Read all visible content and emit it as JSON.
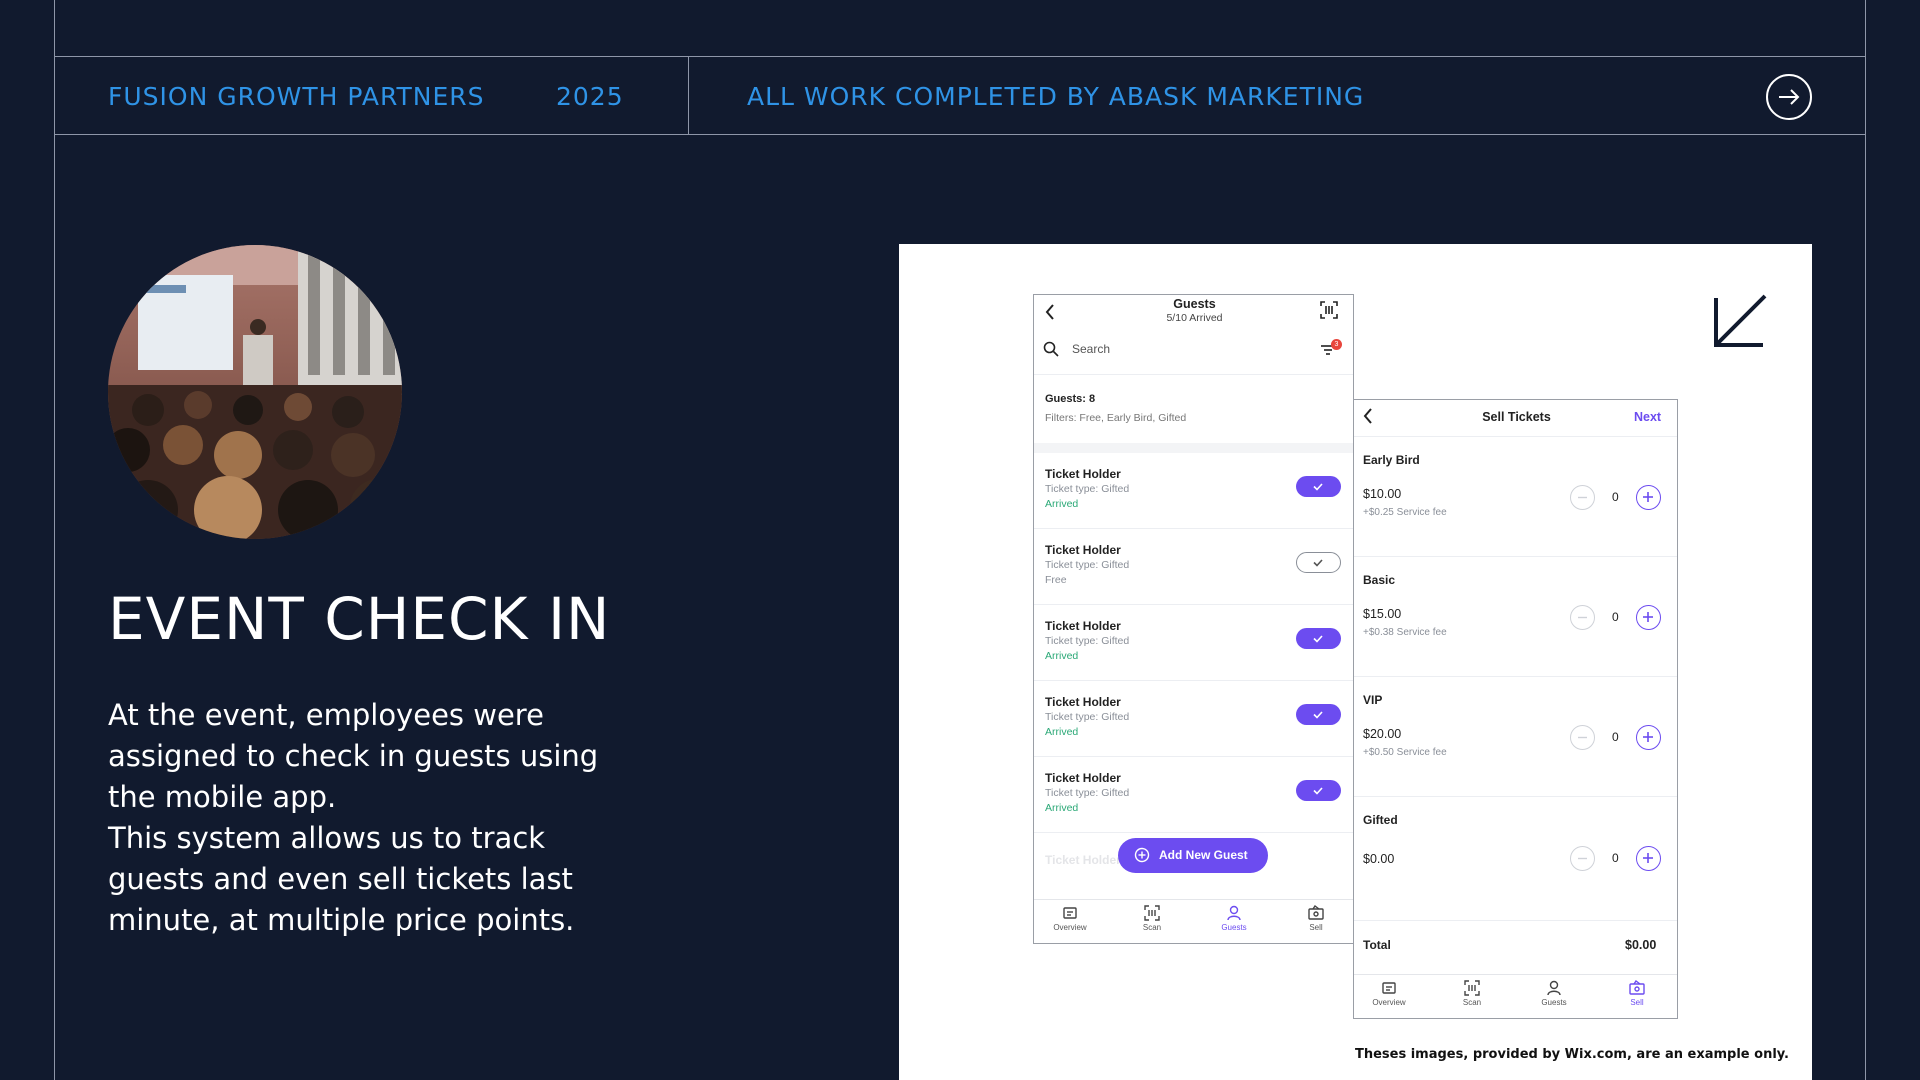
{
  "header": {
    "company": "FUSION GROWTH PARTNERS",
    "year": "2025",
    "credit": "ALL WORK COMPLETED BY ABASK MARKETING",
    "next_icon": "arrow-right-circle-icon"
  },
  "colors": {
    "background": "#111a2e",
    "accent_blue": "#2f93e6",
    "app_purple": "#6c4cf0",
    "arrived_green": "#2aa876"
  },
  "section": {
    "title": "EVENT CHECK IN",
    "body_lines": [
      "At the event, employees were",
      "assigned to check in guests using",
      "the mobile app.",
      "This system allows us to track",
      "guests and even sell tickets last",
      "minute, at multiple price points."
    ]
  },
  "footnote": "Theses images, provided by Wix.com, are an example only.",
  "guests_screen": {
    "title": "Guests",
    "subtitle": "5/10 Arrived",
    "search_placeholder": "Search",
    "filter_badge": "3",
    "count": "Guests: 8",
    "filters": "Filters: Free, Early Bird, Gifted",
    "rows": [
      {
        "name": "Ticket Holder",
        "type": "Ticket type: Gifted",
        "status": "Arrived",
        "checked": true
      },
      {
        "name": "Ticket Holder",
        "type": "Ticket type: Gifted",
        "status": "Free",
        "checked": false
      },
      {
        "name": "Ticket Holder",
        "type": "Ticket type: Gifted",
        "status": "Arrived",
        "checked": true
      },
      {
        "name": "Ticket Holder",
        "type": "Ticket type: Gifted",
        "status": "Arrived",
        "checked": true
      },
      {
        "name": "Ticket Holder",
        "type": "Ticket type: Gifted",
        "status": "Arrived",
        "checked": true
      }
    ],
    "partial_row_name": "Ticket Holder",
    "add_button": "Add New Guest",
    "tabs": [
      {
        "label": "Overview",
        "active": false
      },
      {
        "label": "Scan",
        "active": false
      },
      {
        "label": "Guests",
        "active": true
      },
      {
        "label": "Sell",
        "active": false
      }
    ]
  },
  "sell_screen": {
    "title": "Sell Tickets",
    "next_label": "Next",
    "tickets": [
      {
        "name": "Early Bird",
        "price": "$10.00",
        "fee": "+$0.25 Service fee",
        "qty": "0"
      },
      {
        "name": "Basic",
        "price": "$15.00",
        "fee": "+$0.38 Service fee",
        "qty": "0"
      },
      {
        "name": "VIP",
        "price": "$20.00",
        "fee": "+$0.50 Service fee",
        "qty": "0"
      },
      {
        "name": "Gifted",
        "price": "$0.00",
        "fee": "",
        "qty": "0"
      }
    ],
    "total_label": "Total",
    "total_value": "$0.00",
    "tabs": [
      {
        "label": "Overview",
        "active": false
      },
      {
        "label": "Scan",
        "active": false
      },
      {
        "label": "Guests",
        "active": false
      },
      {
        "label": "Sell",
        "active": true
      }
    ]
  }
}
